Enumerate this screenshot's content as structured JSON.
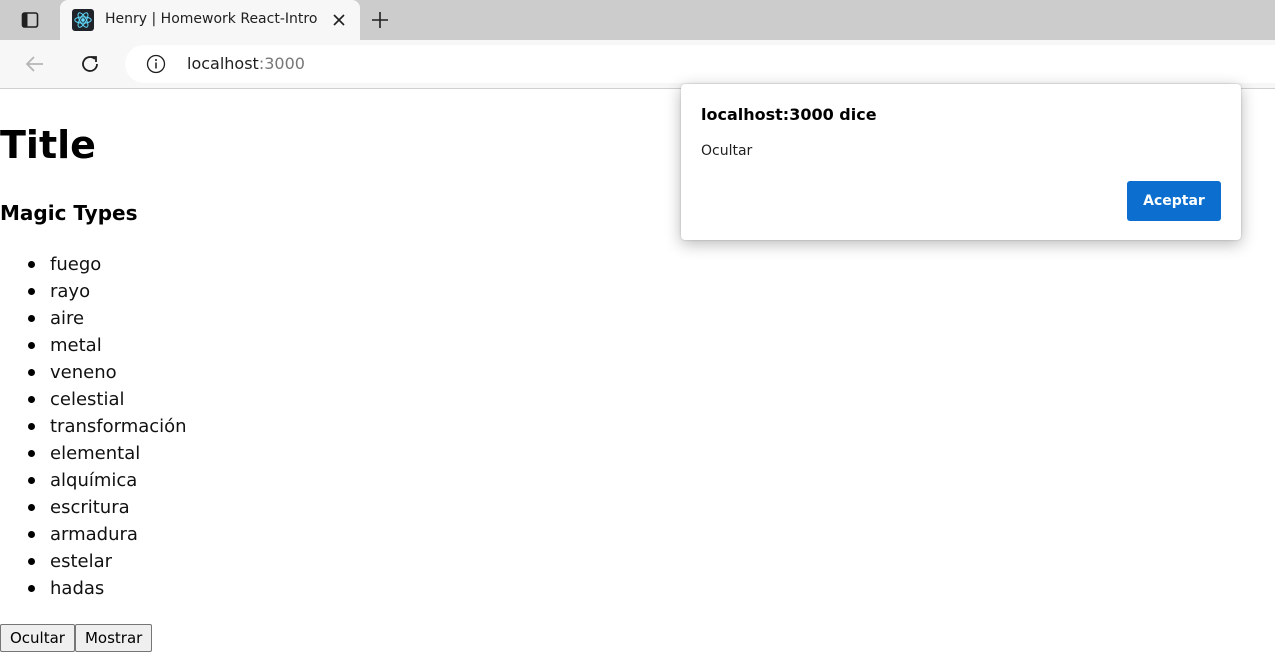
{
  "browser": {
    "tab": {
      "title": "Henry | Homework React-Intro",
      "favicon": "react-icon"
    },
    "address": {
      "host": "localhost",
      "port": ":3000"
    },
    "icons": {
      "tab_actions": "tab-actions-icon",
      "close": "close-icon",
      "new_tab": "plus-icon",
      "back": "back-arrow-icon",
      "reload": "reload-icon",
      "site_info": "info-icon"
    }
  },
  "page": {
    "title": "Title",
    "subtitle": "Magic Types",
    "magic_types": [
      "fuego",
      "rayo",
      "aire",
      "metal",
      "veneno",
      "celestial",
      "transformación",
      "elemental",
      "alquímica",
      "escritura",
      "armadura",
      "estelar",
      "hadas"
    ],
    "buttons": {
      "hide": "Ocultar",
      "show": "Mostrar"
    }
  },
  "dialog": {
    "title": "localhost:3000 dice",
    "message": "Ocultar",
    "ok_label": "Aceptar"
  },
  "colors": {
    "tabstrip_bg": "#cccccc",
    "toolbar_bg": "#f7f7f7",
    "dialog_accent": "#0c6fcf",
    "react_blue": "#61dafb"
  }
}
